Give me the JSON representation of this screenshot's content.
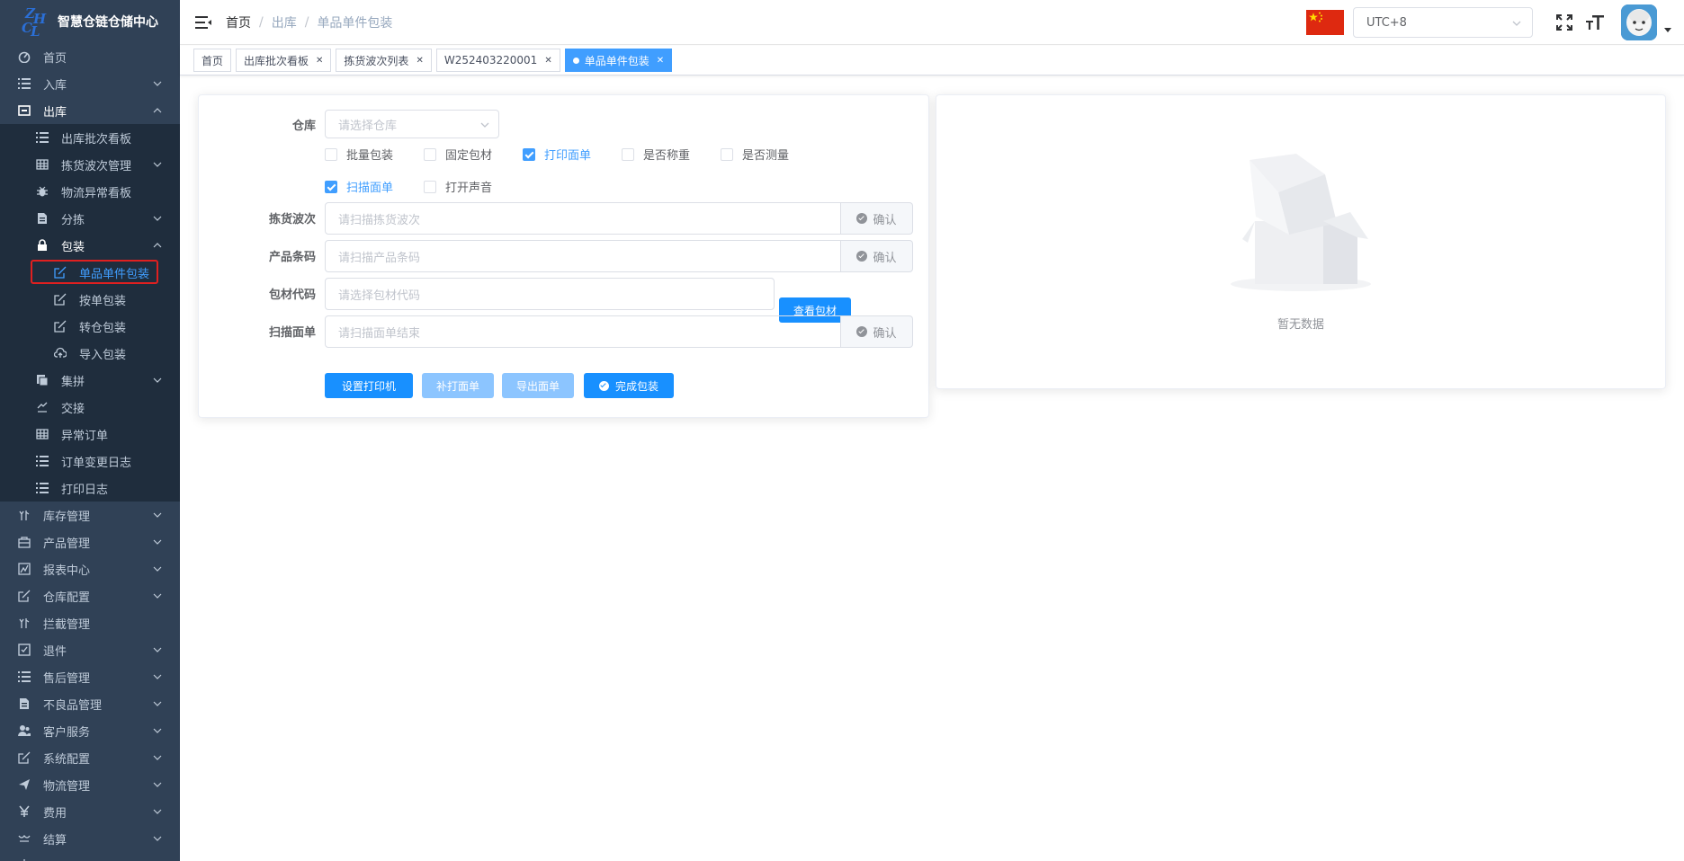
{
  "app": {
    "title": "智慧仓链仓储中心",
    "logo_letters": [
      "Z",
      "H",
      "C",
      "L"
    ]
  },
  "sidebar": {
    "items": [
      {
        "label": "首页",
        "icon": "dashboard-icon",
        "level": 1
      },
      {
        "label": "入库",
        "icon": "list-icon",
        "level": 1,
        "arrow": "down"
      },
      {
        "label": "出库",
        "icon": "outbound-icon",
        "level": 1,
        "arrow": "up"
      },
      {
        "label": "出库批次看板",
        "icon": "list-icon",
        "level": 2
      },
      {
        "label": "拣货波次管理",
        "icon": "table-icon",
        "level": 2,
        "arrow": "down"
      },
      {
        "label": "物流异常看板",
        "icon": "bug-icon",
        "level": 2
      },
      {
        "label": "分拣",
        "icon": "document-icon",
        "level": 2,
        "arrow": "down"
      },
      {
        "label": "包装",
        "icon": "lock-icon",
        "level": 2,
        "arrow": "up"
      },
      {
        "label": "单品单件包装",
        "icon": "edit-icon",
        "level": 3,
        "active": true
      },
      {
        "label": "按单包装",
        "icon": "edit-icon",
        "level": 3
      },
      {
        "label": "转仓包装",
        "icon": "edit-icon",
        "level": 3
      },
      {
        "label": "导入包装",
        "icon": "upload-icon",
        "level": 3
      },
      {
        "label": "集拼",
        "icon": "merge-icon",
        "level": 2,
        "arrow": "down"
      },
      {
        "label": "交接",
        "icon": "handover-icon",
        "level": 2
      },
      {
        "label": "异常订单",
        "icon": "table-icon",
        "level": 2
      },
      {
        "label": "订单变更日志",
        "icon": "list-icon",
        "level": 2
      },
      {
        "label": "打印日志",
        "icon": "list-icon",
        "level": 2
      },
      {
        "label": "库存管理",
        "icon": "stock-icon",
        "level": 1,
        "arrow": "down"
      },
      {
        "label": "产品管理",
        "icon": "product-icon",
        "level": 1,
        "arrow": "down"
      },
      {
        "label": "报表中心",
        "icon": "report-icon",
        "level": 1,
        "arrow": "down"
      },
      {
        "label": "仓库配置",
        "icon": "edit-icon",
        "level": 1,
        "arrow": "down"
      },
      {
        "label": "拦截管理",
        "icon": "stock-icon",
        "level": 1
      },
      {
        "label": "退件",
        "icon": "checkbox-icon",
        "level": 1,
        "arrow": "down"
      },
      {
        "label": "售后管理",
        "icon": "list-icon",
        "level": 1,
        "arrow": "down"
      },
      {
        "label": "不良品管理",
        "icon": "document-icon",
        "level": 1,
        "arrow": "down"
      },
      {
        "label": "客户服务",
        "icon": "users-icon",
        "level": 1,
        "arrow": "down"
      },
      {
        "label": "系统配置",
        "icon": "edit-icon",
        "level": 1,
        "arrow": "down"
      },
      {
        "label": "物流管理",
        "icon": "send-icon",
        "level": 1,
        "arrow": "down"
      },
      {
        "label": "费用",
        "icon": "yen-icon",
        "level": 1,
        "arrow": "down"
      },
      {
        "label": "结算",
        "icon": "settle-icon",
        "level": 1,
        "arrow": "down"
      },
      {
        "label": "系统",
        "icon": "system-icon",
        "level": 1
      }
    ]
  },
  "header": {
    "breadcrumb": [
      "首页",
      "出库",
      "单品单件包装"
    ],
    "timezone": "UTC+8"
  },
  "tags": [
    {
      "label": "首页",
      "closable": false
    },
    {
      "label": "出库批次看板",
      "closable": true
    },
    {
      "label": "拣货波次列表",
      "closable": true
    },
    {
      "label": "W252403220001",
      "closable": true
    },
    {
      "label": "单品单件包装",
      "closable": true,
      "active": true
    }
  ],
  "form": {
    "warehouse_label": "仓库",
    "warehouse_placeholder": "请选择仓库",
    "checkboxes": [
      {
        "label": "批量包装",
        "checked": false
      },
      {
        "label": "固定包材",
        "checked": false
      },
      {
        "label": "打印面单",
        "checked": true
      },
      {
        "label": "是否称重",
        "checked": false
      },
      {
        "label": "是否测量",
        "checked": false
      },
      {
        "label": "扫描面单",
        "checked": true
      },
      {
        "label": "打开声音",
        "checked": false
      }
    ],
    "wave_label": "拣货波次",
    "wave_placeholder": "请扫描拣货波次",
    "barcode_label": "产品条码",
    "barcode_placeholder": "请扫描产品条码",
    "material_label": "包材代码",
    "material_placeholder": "请选择包材代码",
    "view_material": "查看包材",
    "label_label": "扫描面单",
    "label_placeholder": "请扫描面单结束",
    "confirm": "确认",
    "buttons": {
      "set_printer": "设置打印机",
      "reprint": "补打面单",
      "export": "导出面单",
      "finish": "完成包装"
    }
  },
  "empty": {
    "text": "暂无数据"
  },
  "colors": {
    "sidebar_bg": "#304156",
    "sidebar_sub_bg": "#1f2d3d",
    "primary": "#1890ff",
    "active_text": "#409eff",
    "highlight_border": "#e02020"
  }
}
